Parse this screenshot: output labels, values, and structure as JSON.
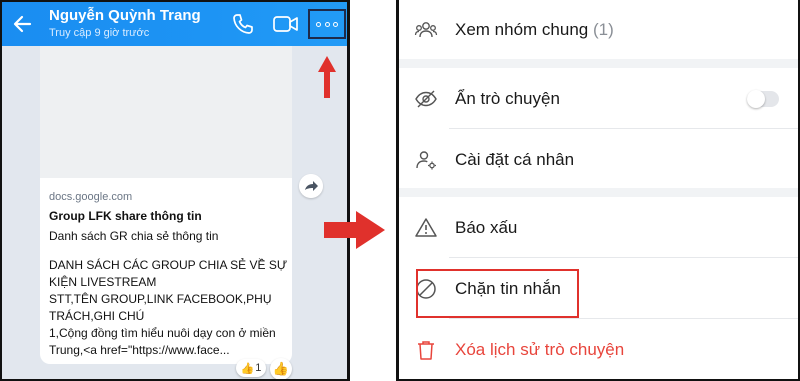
{
  "chat": {
    "contact_name": "Nguyễn Quỳnh Trang",
    "last_seen": "Truy cập 9 giờ trước",
    "link_preview": {
      "domain": "docs.google.com",
      "title": "Group LFK share thông tin",
      "description": "Danh sách GR chia sẻ thông tin",
      "body": "DANH SÁCH CÁC GROUP CHIA SẺ VỀ SỰ KIỆN LIVESTREAM\nSTT,TÊN GROUP,LINK FACEBOOK,PHỤ TRÁCH,GHI CHÚ\n1,Cộng đồng tìm hiểu nuôi dạy con ở miền Trung,<a href=\"https://www.face..."
    },
    "reaction": {
      "emoji": "👍",
      "count": "1"
    },
    "like_emoji": "👍"
  },
  "options": {
    "view_group": {
      "label": "Xem nhóm chung",
      "count": "(1)"
    },
    "hide_chat": {
      "label": "Ẩn trò chuyện",
      "toggle_on": false
    },
    "personal_settings": {
      "label": "Cài đặt cá nhân"
    },
    "report": {
      "label": "Báo xấu"
    },
    "block": {
      "label": "Chặn tin nhắn"
    },
    "delete_history": {
      "label": "Xóa lịch sử trò chuyện"
    }
  },
  "colors": {
    "header_blue": "#1a8df1",
    "annotation_red": "#e0312c",
    "delete_red": "#e8453c"
  }
}
